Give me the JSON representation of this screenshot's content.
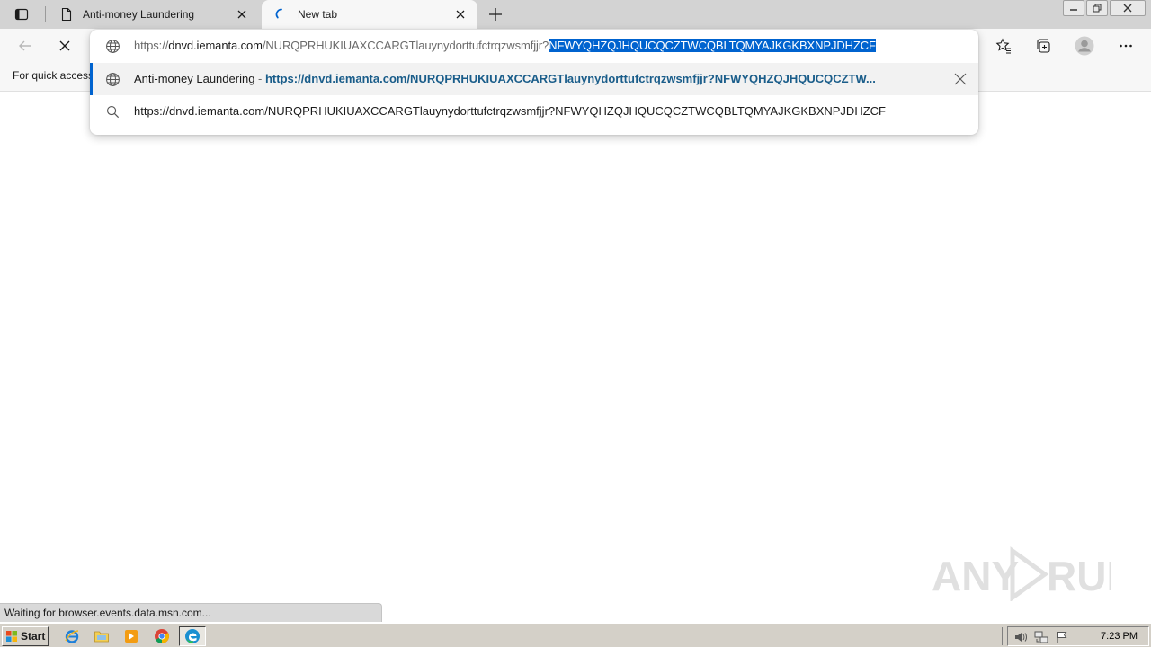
{
  "tabs": [
    {
      "title": "Anti-money Laundering",
      "active": false
    },
    {
      "title": "New tab",
      "active": true
    }
  ],
  "omnibox": {
    "prefix": "https://",
    "host": "dnvd.iemanta.com",
    "path_dim": "/NURQPRHUKIUAXCCARGTlauynydorttufctrqzwsmfjjr?",
    "selected": "NFWYQHZQJHQUCQCZTWCQBLTQMYAJKGKBXNPJDHZCF"
  },
  "suggestions": [
    {
      "title": "Anti-money Laundering",
      "separator": " - ",
      "url": "https://dnvd.iemanta.com/NURQPRHUKIUAXCCARGTlauynydorttufctrqzwsmfjjr?NFWYQHZQJHQUCQCZTW..."
    },
    {
      "text": "https://dnvd.iemanta.com/NURQPRHUKIUAXCCARGTlauynydorttufctrqzwsmfjjr?NFWYQHZQJHQUCQCZTWCQBLTQMYAJKGKBXNPJDHZCF"
    }
  ],
  "favorites_bar": {
    "text": "For quick access"
  },
  "status_text": "Waiting for browser.events.data.msn.com...",
  "watermark": "ANY RUN",
  "taskbar": {
    "start_label": "Start",
    "clock": "7:23 PM"
  },
  "colors": {
    "accent": "#0063cf",
    "suggestion_url": "#1a5d8a"
  }
}
